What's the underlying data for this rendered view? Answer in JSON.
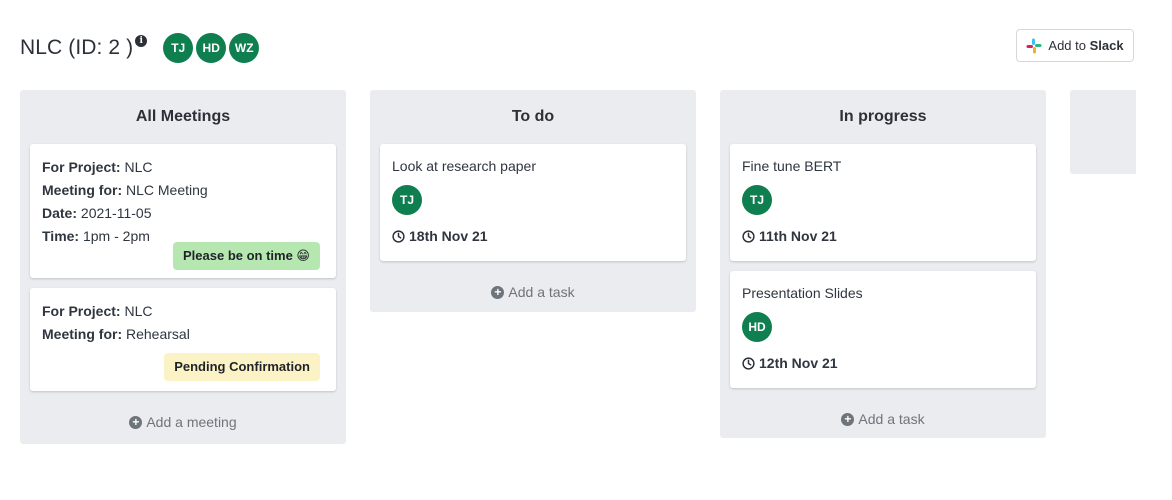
{
  "header": {
    "title": "NLC (ID: 2 )",
    "info_icon": "info-circle-icon",
    "members": [
      "TJ",
      "HD",
      "WZ"
    ],
    "slack_button": {
      "prefix": "Add to ",
      "brand": "Slack"
    }
  },
  "colors": {
    "avatar": "#0f7f4f",
    "column_bg": "#ebecf0",
    "badge_green": "#b7e7b0",
    "badge_yellow": "#fbf3c6"
  },
  "columns": [
    {
      "title": "All Meetings",
      "meetings": [
        {
          "project_key": "For Project:",
          "project": " NLC",
          "meeting_key": "Meeting for:",
          "meeting": " NLC Meeting",
          "date_key": "Date:",
          "date": " 2021-11-05",
          "time_key": "Time:",
          "time": " 1pm - 2pm",
          "status": "Please be on time 😁"
        },
        {
          "project_key": "For Project:",
          "project": " NLC",
          "meeting_key": "Meeting for:",
          "meeting": " Rehearsal",
          "status": "Pending Confirmation"
        }
      ],
      "add_label": "Add a meeting"
    },
    {
      "title": "To do",
      "tasks": [
        {
          "name": "Look at research paper",
          "assignee": "TJ",
          "due": "18th Nov 21"
        }
      ],
      "add_label": "Add a task"
    },
    {
      "title": "In progress",
      "tasks": [
        {
          "name": "Fine tune BERT",
          "assignee": "TJ",
          "due": "11th Nov 21"
        },
        {
          "name": "Presentation Slides",
          "assignee": "HD",
          "due": "12th Nov 21"
        }
      ],
      "add_label": "Add a task"
    }
  ]
}
